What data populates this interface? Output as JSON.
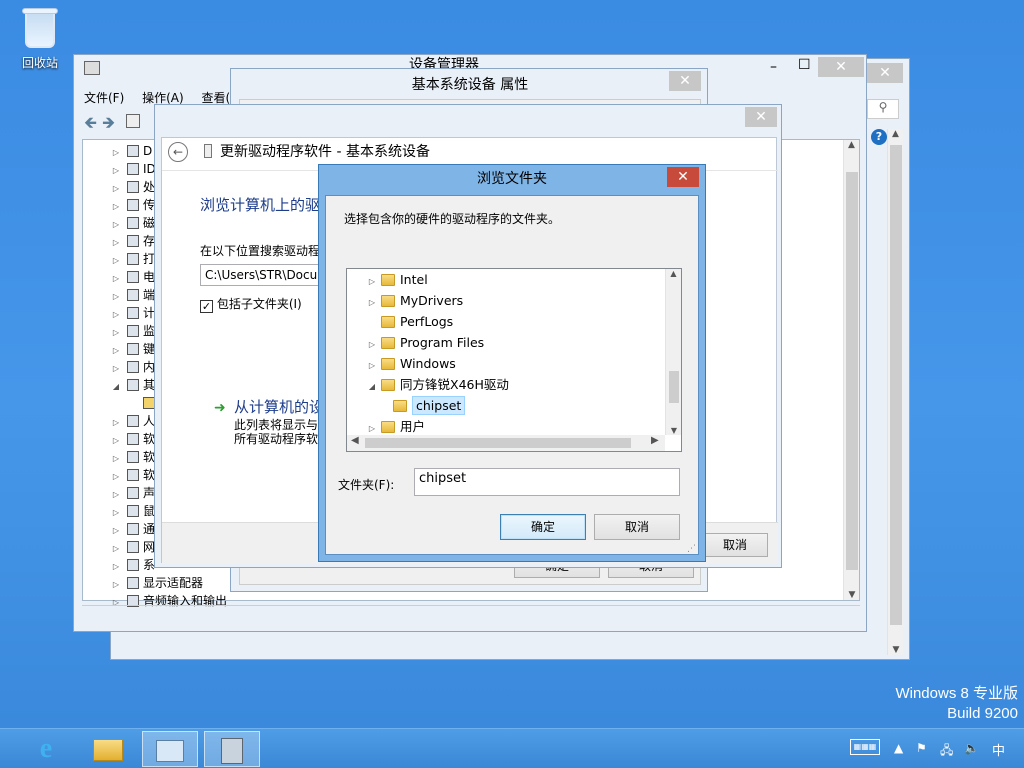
{
  "desktop": {
    "recycle_bin_label": "回收站",
    "watermark_line1": "Windows 8 专业版",
    "watermark_line2": "Build 9200"
  },
  "device_manager": {
    "title": "设备管理器",
    "menu": [
      "文件(F)",
      "操作(A)",
      "查看("
    ],
    "tree_items": [
      "D",
      "ID",
      "处",
      "传",
      "磁",
      "存",
      "打",
      "电",
      "端",
      "计",
      "监",
      "键",
      "内",
      "其",
      "",
      "人",
      "软",
      "软",
      "软",
      "声",
      "鼠",
      "通",
      "网",
      "系",
      "显示适配器",
      "音频输入和输出"
    ]
  },
  "properties_dialog": {
    "title": "基本系统设备 属性",
    "ok_label": "确定",
    "cancel_label": "取消"
  },
  "update_driver": {
    "title": "更新驱动程序软件 - 基本系统设备",
    "heading": "浏览计算机上的驱",
    "search_label": "在以下位置搜索驱动程",
    "path_value": "C:\\Users\\STR\\Docu",
    "include_subfolders": "包括子文件夹(I)",
    "pick_link": "从计算机的设",
    "pick_desc_line1": "此列表将显示与",
    "pick_desc_line2": "所有驱动程序软",
    "cancel_label": "取消"
  },
  "browse_dialog": {
    "title": "浏览文件夹",
    "instruction": "选择包含你的硬件的驱动程序的文件夹。",
    "tree": [
      {
        "label": "Intel",
        "expander": "▷",
        "selected": false,
        "indent": 0
      },
      {
        "label": "MyDrivers",
        "expander": "▷",
        "selected": false,
        "indent": 0
      },
      {
        "label": "PerfLogs",
        "expander": "",
        "selected": false,
        "indent": 0
      },
      {
        "label": "Program Files",
        "expander": "▷",
        "selected": false,
        "indent": 0
      },
      {
        "label": "Windows",
        "expander": "▷",
        "selected": false,
        "indent": 0
      },
      {
        "label": "同方锋锐X46H驱动",
        "expander": "◢",
        "selected": false,
        "indent": 0
      },
      {
        "label": "chipset",
        "expander": "",
        "selected": true,
        "indent": 1
      },
      {
        "label": "用户",
        "expander": "▷",
        "selected": false,
        "indent": 0
      }
    ],
    "folder_label": "文件夹(F):",
    "folder_value": "chipset",
    "ok_label": "确定",
    "cancel_label": "取消"
  },
  "taskbar": {
    "ime_label": "中"
  }
}
